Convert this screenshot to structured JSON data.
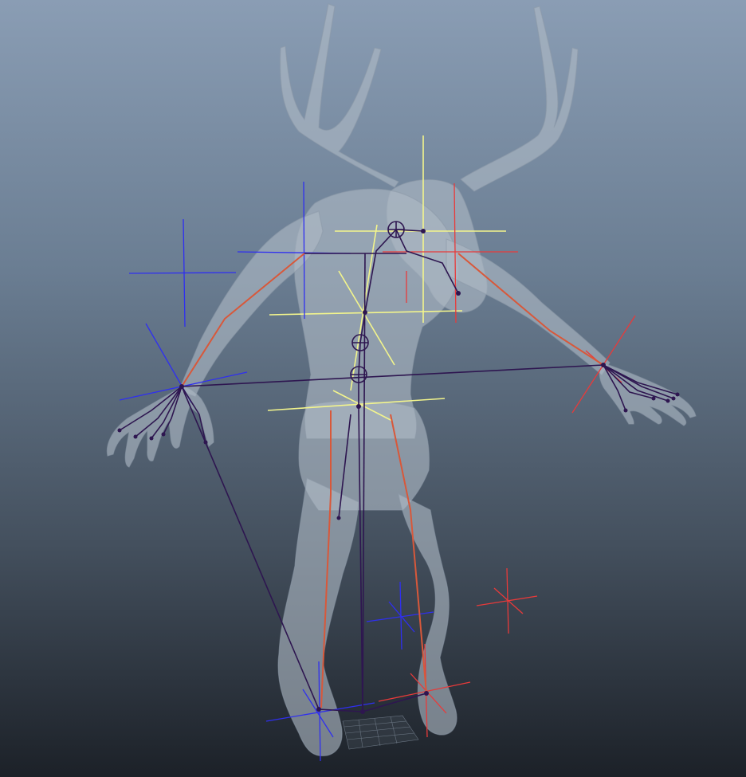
{
  "viewport": {
    "background_top": "#8a9db4",
    "background_bottom": "#1c2128"
  },
  "scene": {
    "mesh_color": "#a7b3c0",
    "joint_color": "#2e1650",
    "left_side_color": "#2f2ff0",
    "right_side_color": "#e83a3a",
    "center_color": "#f3f58c",
    "limb_bone_color": "#d8583a"
  }
}
